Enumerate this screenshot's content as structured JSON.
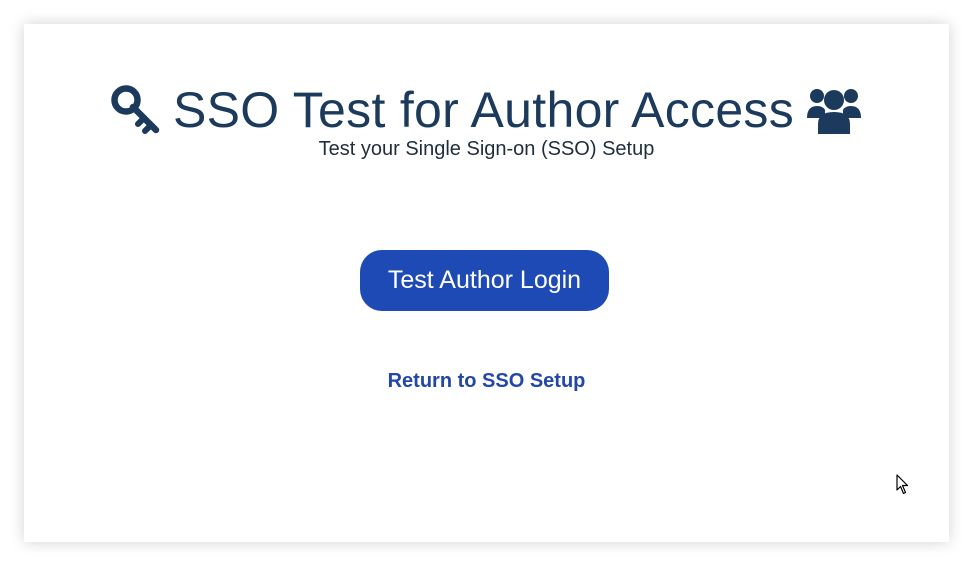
{
  "page": {
    "title": "SSO Test for Author Access",
    "subtitle": "Test your Single Sign-on (SSO) Setup",
    "primary_button_label": "Test Author Login",
    "return_link_label": "Return to SSO Setup"
  },
  "icons": {
    "left": "key-icon",
    "right": "users-icon",
    "pointer": "mouse-cursor-icon"
  },
  "colors": {
    "title": "#1b3a5c",
    "button_bg": "#1d4ab4",
    "link": "#2347a6"
  }
}
